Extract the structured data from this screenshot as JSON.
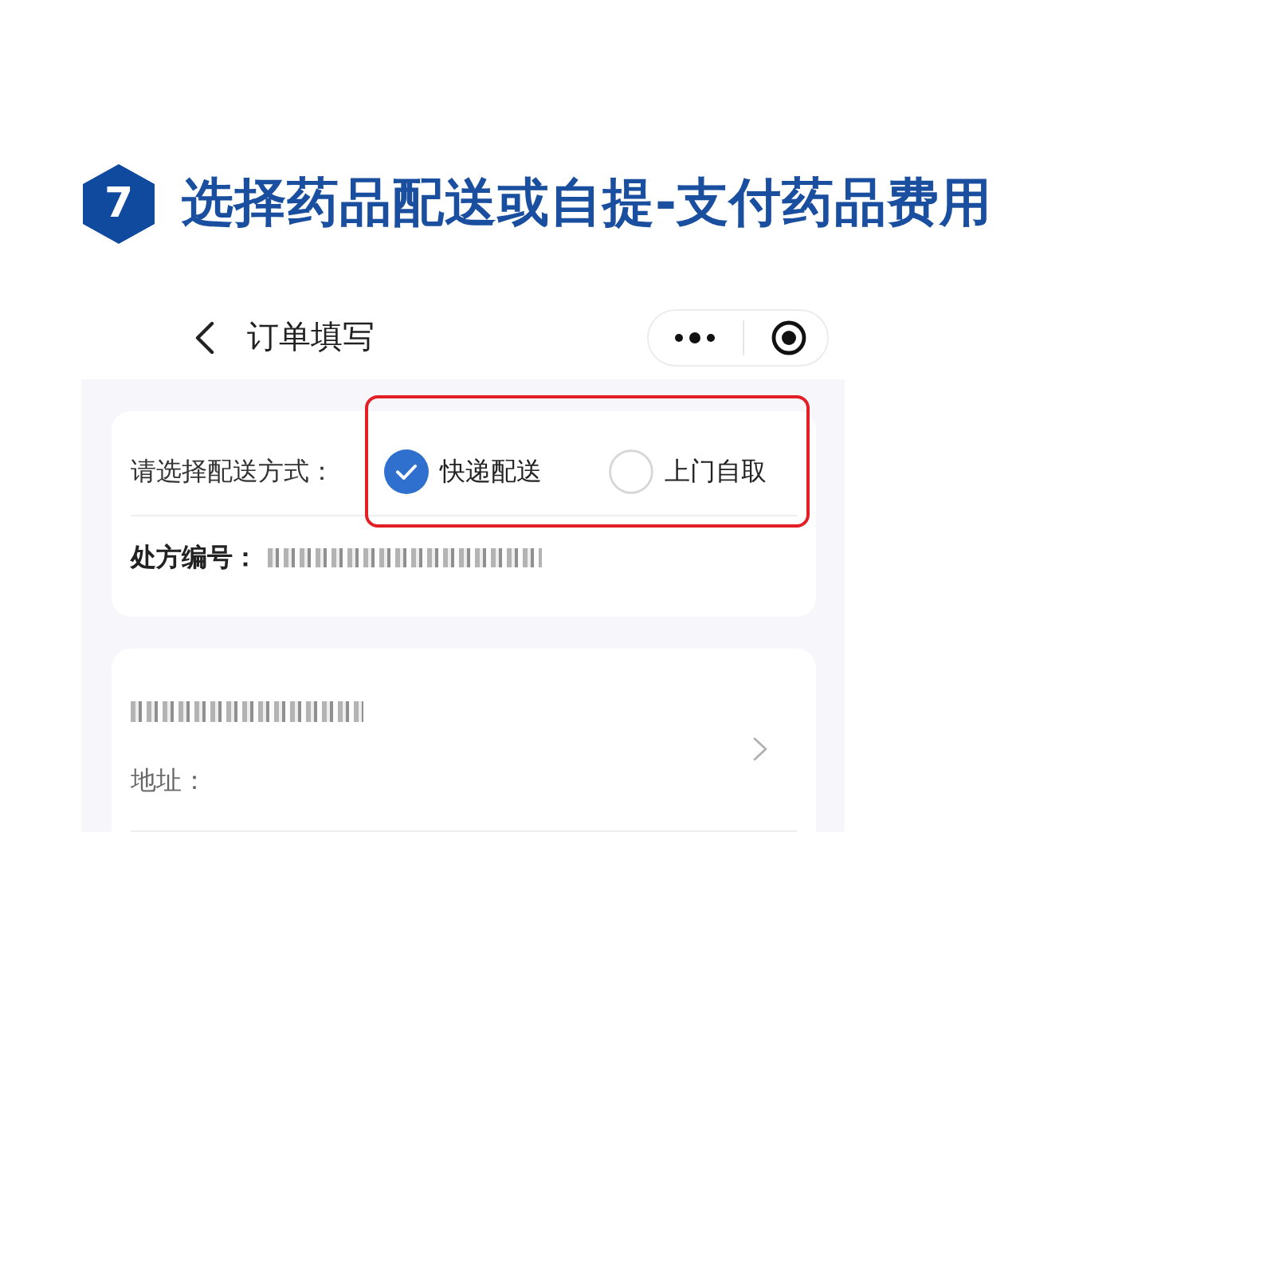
{
  "heading": {
    "step": "7",
    "title": "选择药品配送或自提-支付药品费用"
  },
  "nav_bar": {
    "title": "订单填写"
  },
  "delivery_card": {
    "label": "请选择配送方式：",
    "highlighted": true,
    "options": [
      {
        "label": "快递配送",
        "selected": true
      },
      {
        "label": "上门自取",
        "selected": false
      }
    ],
    "prescription_label": "处方编号："
  },
  "address_card": {
    "address_label": "地址："
  }
}
